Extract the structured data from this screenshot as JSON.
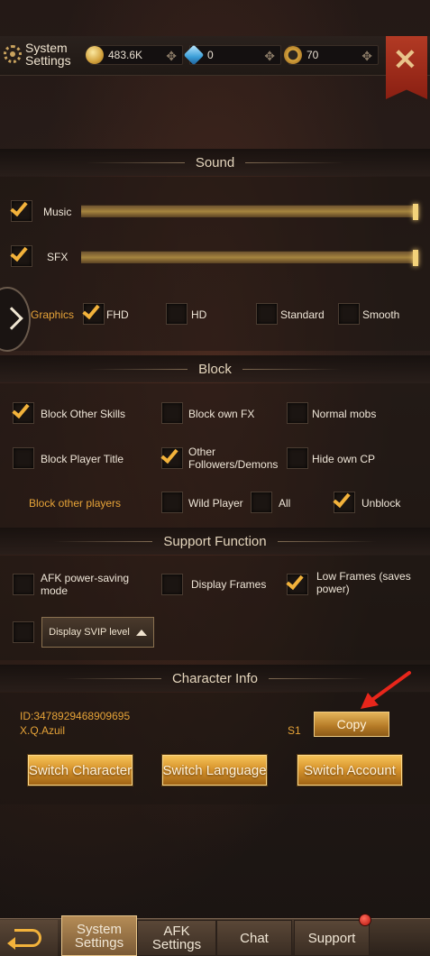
{
  "header": {
    "title": "System Settings",
    "resources": [
      {
        "icon": "gold-coin-icon",
        "value": "483.6K"
      },
      {
        "icon": "diamond-icon",
        "value": "0"
      },
      {
        "icon": "medal-icon",
        "value": "70"
      }
    ]
  },
  "sound": {
    "title": "Sound",
    "music_label": "Music",
    "sfx_label": "SFX",
    "music_checked": true,
    "sfx_checked": true,
    "music_level": 1.0,
    "sfx_level": 1.0
  },
  "graphics": {
    "label": "Graphics",
    "options": [
      "FHD",
      "HD",
      "Standard",
      "Smooth"
    ],
    "selected": "FHD"
  },
  "block": {
    "title": "Block",
    "options": [
      {
        "label": "Block Other Skills",
        "checked": true
      },
      {
        "label": "Block own FX",
        "checked": false
      },
      {
        "label": "Normal mobs",
        "checked": false
      },
      {
        "label": "Block Player Title",
        "checked": false
      },
      {
        "label": "Other Followers/Demons",
        "checked": true
      },
      {
        "label": "Hide own CP",
        "checked": false
      }
    ],
    "players_label": "Block other players",
    "players_options": [
      "Wild Player",
      "All",
      "Unblock"
    ],
    "players_selected": "Unblock"
  },
  "support": {
    "title": "Support Function",
    "options": [
      {
        "label": "AFK power-saving mode",
        "checked": false
      },
      {
        "label": "Display Frames",
        "checked": false
      },
      {
        "label": "Low Frames (saves power)",
        "checked": true
      }
    ],
    "svip_label": "Display SVIP level"
  },
  "character": {
    "title": "Character Info",
    "id": "ID:3478929468909695",
    "name": "X.Q.Azuil",
    "server": "S1",
    "copy_label": "Copy",
    "buttons": [
      "Switch Character",
      "Switch Language",
      "Switch Account"
    ]
  },
  "tabs": {
    "system": "System Settings",
    "afk": "AFK Settings",
    "chat": "Chat",
    "support": "Support"
  },
  "colors": {
    "accent": "#f2b23b",
    "gold_label": "#e6a338",
    "close_banner": "#b23a24"
  }
}
